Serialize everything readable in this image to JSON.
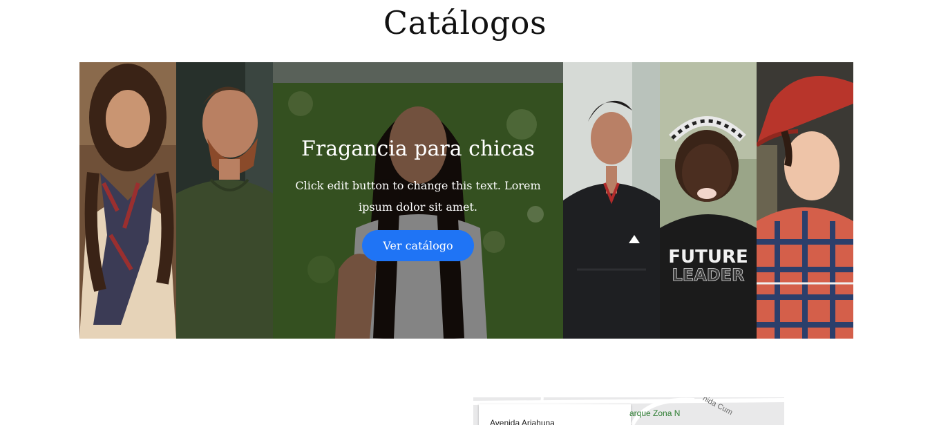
{
  "page": {
    "title": "Catálogos"
  },
  "gallery": {
    "panels": [
      {
        "name": "woman-scarf",
        "bg": "#7a5a3e"
      },
      {
        "name": "bearded-man",
        "bg": "#2d3a33"
      },
      {
        "name": "girl-green-wall",
        "bg": "#4f7a32"
      },
      {
        "name": "young-man-jacket",
        "bg": "#cfd3d0"
      },
      {
        "name": "child-future-leader",
        "bg": "#8e9a7c"
      },
      {
        "name": "boy-red-cap",
        "bg": "#3c3a36"
      }
    ],
    "featured": {
      "title": "Fragancia para chicas",
      "text": "Click edit button to change this text. Lorem ipsum dolor sit amet.",
      "button_label": "Ver catálogo"
    },
    "shirt_text_line1": "FUTURE",
    "shirt_text_line2": "LEADER"
  },
  "map": {
    "place_label": "Avenida Ariahuna",
    "park_label": "arque Zona N",
    "street_label": "nida Cum"
  },
  "colors": {
    "accent": "#1f74f5",
    "title": "#111111"
  }
}
